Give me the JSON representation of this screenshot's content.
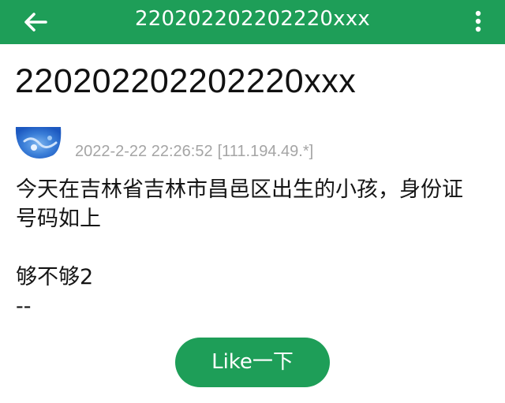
{
  "appbar": {
    "title": "220202202202220xxx",
    "back_icon": "arrow-left-icon",
    "more_icon": "more-vertical-icon",
    "color": "#1e9e58"
  },
  "post": {
    "title": "220202202202220xxx",
    "timestamp": "2022-2-22 22:26:52",
    "ip": "[111.194.49.*]",
    "body_line1": "今天在吉林省吉林市昌邑区出生的小孩，身份证号码如上",
    "body_line2": "够不够2",
    "body_line3": "--"
  },
  "like_button": {
    "label": "Like一下",
    "color": "#1e9e58"
  }
}
